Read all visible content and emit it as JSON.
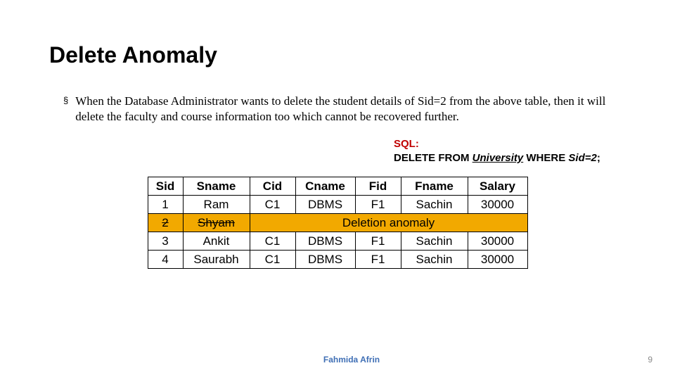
{
  "title": "Delete Anomaly",
  "bullet_glyph": "§",
  "body_text": "When the Database Administrator wants to delete the student details of Sid=2 from the above table, then it will delete the faculty and course information too which cannot be recovered further.",
  "sql": {
    "label": "SQL:",
    "prefix": "DELETE FROM ",
    "table": "University",
    "mid": " WHERE ",
    "sid": "Sid=2",
    "suffix": ";"
  },
  "table": {
    "headers": [
      "Sid",
      "Sname",
      "Cid",
      "Cname",
      "Fid",
      "Fname",
      "Salary"
    ],
    "rows": [
      {
        "cells": [
          "1",
          "Ram",
          "C1",
          "DBMS",
          "F1",
          "Sachin",
          "30000"
        ],
        "anomaly": false
      },
      {
        "cells": [
          "2",
          "Shyam"
        ],
        "anomaly": true,
        "anomaly_text": "Deletion anomaly"
      },
      {
        "cells": [
          "3",
          "Ankit",
          "C1",
          "DBMS",
          "F1",
          "Sachin",
          "30000"
        ],
        "anomaly": false
      },
      {
        "cells": [
          "4",
          "Saurabh",
          "C1",
          "DBMS",
          "F1",
          "Sachin",
          "30000"
        ],
        "anomaly": false
      }
    ]
  },
  "footer": {
    "author": "Fahmida Afrin",
    "page": "9"
  }
}
